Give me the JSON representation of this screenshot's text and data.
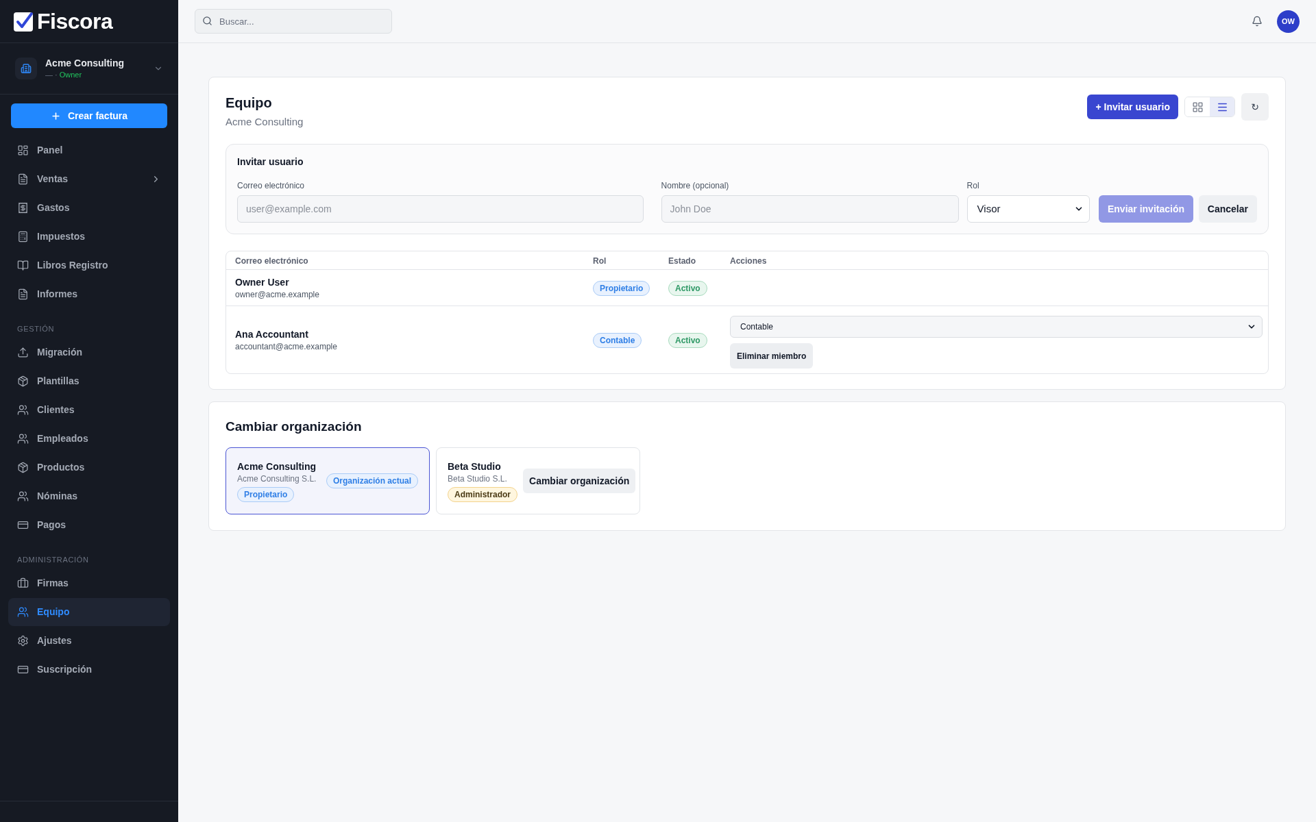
{
  "sidebar": {
    "brand": "Fiscora",
    "organization": {
      "name": "Acme Consulting",
      "detail": "— ·",
      "role": "Owner"
    },
    "create_button": "Crear factura",
    "sections": [
      {
        "items": [
          {
            "label": "Panel",
            "selected": false,
            "has_submenu": false
          },
          {
            "label": "Ventas",
            "selected": false,
            "has_submenu": true
          },
          {
            "label": "Gastos",
            "selected": false,
            "has_submenu": false
          },
          {
            "label": "Impuestos",
            "selected": false,
            "has_submenu": false
          },
          {
            "label": "Libros Registro",
            "selected": false,
            "has_submenu": false
          },
          {
            "label": "Informes",
            "selected": false,
            "has_submenu": false
          }
        ]
      },
      {
        "heading": "GESTIÓN",
        "items": [
          {
            "label": "Migración",
            "selected": false,
            "has_submenu": false
          },
          {
            "label": "Plantillas",
            "selected": false,
            "has_submenu": false
          },
          {
            "label": "Clientes",
            "selected": false,
            "has_submenu": false
          },
          {
            "label": "Empleados",
            "selected": false,
            "has_submenu": false
          },
          {
            "label": "Productos",
            "selected": false,
            "has_submenu": false
          },
          {
            "label": "Nóminas",
            "selected": false,
            "has_submenu": false
          },
          {
            "label": "Pagos",
            "selected": false,
            "has_submenu": false
          }
        ]
      },
      {
        "heading": "ADMINISTRACIÓN",
        "items": [
          {
            "label": "Firmas",
            "selected": false,
            "has_submenu": false
          },
          {
            "label": "Equipo",
            "selected": true,
            "has_submenu": false
          },
          {
            "label": "Ajustes",
            "selected": false,
            "has_submenu": false
          },
          {
            "label": "Suscripción",
            "selected": false,
            "has_submenu": false
          }
        ]
      }
    ]
  },
  "top_bar": {
    "search": {
      "placeholder": "Buscar..."
    },
    "avatar": "OW"
  },
  "team": {
    "title": "Equipo",
    "subtitle": "Acme Consulting",
    "invite_button": "+ Invitar usuario",
    "view_modes": [
      {
        "kind": "grid",
        "selected": false
      },
      {
        "kind": "list",
        "selected": true
      }
    ],
    "refresh_button": "↻"
  },
  "invite_form": {
    "title": "Invitar usuario",
    "fields": [
      {
        "kind": "input",
        "label": "Correo electrónico",
        "placeholder": "user@example.com"
      },
      {
        "kind": "input",
        "label": "Nombre (opcional)",
        "placeholder": "John Doe"
      },
      {
        "kind": "select",
        "label": "Rol",
        "value": "Visor"
      }
    ],
    "submit_button": {
      "label": "Enviar invitación",
      "disabled": true
    },
    "cancel_button": "Cancelar"
  },
  "members_table": {
    "columns": [
      "Correo electrónico",
      "Rol",
      "Estado",
      "Acciones"
    ],
    "rows": [
      {
        "name": "Owner User",
        "email": "owner@acme.example",
        "role": "Propietario",
        "status": "Activo"
      },
      {
        "name": "Ana Accountant",
        "email": "accountant@acme.example",
        "role": "Contable",
        "status": "Activo",
        "role_select": "Contable",
        "remove_button": "Eliminar miembro"
      }
    ]
  },
  "switch_org": {
    "title": "Cambiar organización",
    "orgs": [
      {
        "name": "Acme Consulting",
        "legal_name": "Acme Consulting S.L.",
        "role": {
          "label": "Propietario",
          "kind": "owner"
        },
        "selected": true,
        "current_label": "Organización actual"
      },
      {
        "name": "Beta Studio",
        "legal_name": "Beta Studio S.L.",
        "role": {
          "label": "Administrador",
          "kind": "admin"
        },
        "selected": false,
        "switch_button": "Cambiar organización"
      }
    ]
  }
}
